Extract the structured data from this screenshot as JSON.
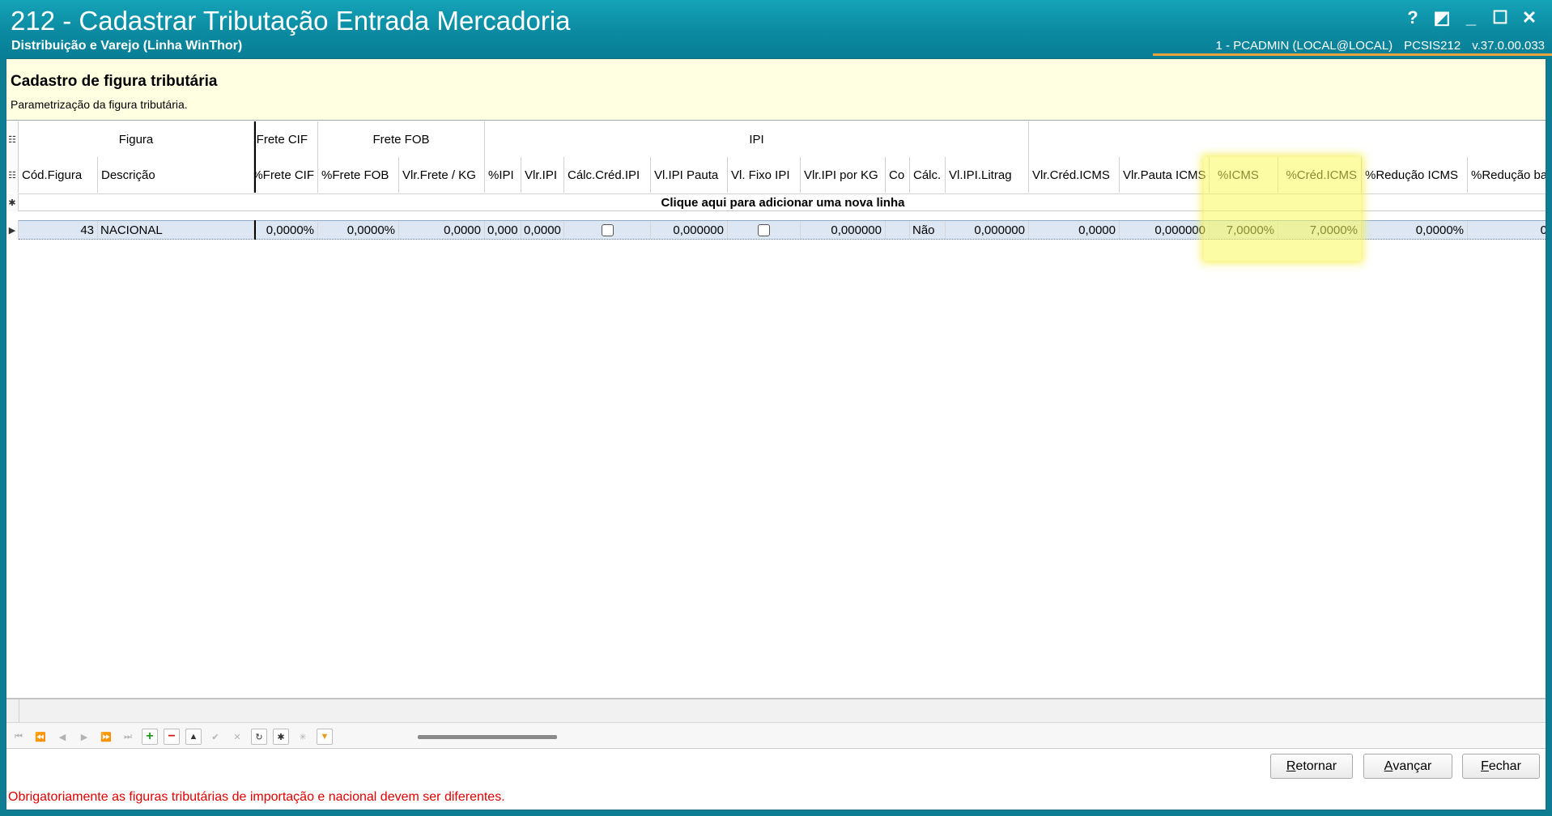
{
  "window": {
    "title": "212 - Cadastrar Tributação Entrada Mercadoria",
    "subtitle": "Distribuição e Varejo (Linha WinThor)",
    "user": "1 - PCADMIN (LOCAL@LOCAL)",
    "program": "PCSIS212",
    "version": "v.37.0.00.033",
    "controls": {
      "help": "?",
      "restore": "◩",
      "minimize": "_",
      "maximize": "☐",
      "close": "✕"
    }
  },
  "header": {
    "title": "Cadastro de figura tributária",
    "description": "Parametrização da figura tributária."
  },
  "grid": {
    "bands": {
      "figura": "Figura",
      "frete_cif": "Frete CIF",
      "frete_fob": "Frete FOB",
      "ipi": "IPI"
    },
    "columns": {
      "cod_figura": "Cód.Figura",
      "descricao": "Descrição",
      "pct_frete_cif": "%Frete CIF",
      "pct_frete_fob": "%Frete FOB",
      "vlr_frete_kg": "Vlr.Frete / KG",
      "pct_ipi": "%IPI",
      "vlr_ipi": "Vlr.IPI",
      "calc_cred_ipi": "Cálc.Créd.IPI",
      "vl_ipi_pauta": "Vl.IPI Pauta",
      "vl_fixo_ipi": "Vl. Fixo IPI",
      "vlr_ipi_kg": "Vlr.IPI por KG",
      "col_co": "Co",
      "col_calc": "Cálc.",
      "vl_ipi_litragem": "Vl.IPI.Litrag",
      "vlr_cred_icms": "Vlr.Créd.ICMS",
      "vlr_pauta_icms": "Vlr.Pauta ICMS",
      "pct_icms": "%ICMS",
      "pct_cred_icms": "%Créd.ICMS",
      "pct_reducao_icms": "%Redução ICMS",
      "pct_reducao_base": "%Redução ba"
    },
    "new_row_text": "Clique aqui para adicionar uma nova linha",
    "row": {
      "cod_figura": "43",
      "descricao": "NACIONAL",
      "pct_frete_cif": "0,0000%",
      "pct_frete_fob": "0,0000%",
      "vlr_frete_kg": "0,0000",
      "pct_ipi": "0,000",
      "vlr_ipi": "0,0000",
      "calc_cred_ipi": false,
      "vl_ipi_pauta": "0,000000",
      "vl_fixo_ipi": false,
      "vlr_ipi_kg": "0,000000",
      "col_calc": "Não",
      "vl_ipi_litragem": "0,000000",
      "vlr_cred_icms": "0,0000",
      "vlr_pauta_icms": "0,000000",
      "pct_icms": "7,0000%",
      "pct_cred_icms": "7,0000%",
      "pct_reducao_icms": "0,0000%",
      "pct_reducao_base": "0"
    }
  },
  "buttons": {
    "retornar": {
      "before": "",
      "key": "R",
      "after": "etornar"
    },
    "avancar": {
      "before": "",
      "key": "A",
      "after": "vançar"
    },
    "fechar": {
      "before": "",
      "key": "F",
      "after": "echar"
    }
  },
  "status": {
    "error": "Obrigatoriamente as figuras tributárias de importação e nacional devem ser diferentes."
  },
  "colors": {
    "title_bar": "#0b8aa1",
    "header_bg": "#ffffe1",
    "highlight": "#fafa5a",
    "error_text": "#e00000"
  }
}
